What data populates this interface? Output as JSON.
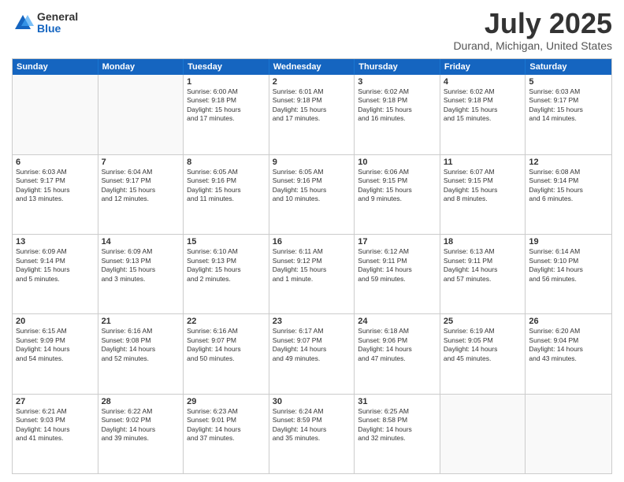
{
  "header": {
    "logo_general": "General",
    "logo_blue": "Blue",
    "month_year": "July 2025",
    "location": "Durand, Michigan, United States"
  },
  "days_of_week": [
    "Sunday",
    "Monday",
    "Tuesday",
    "Wednesday",
    "Thursday",
    "Friday",
    "Saturday"
  ],
  "weeks": [
    [
      {
        "day": "",
        "text": ""
      },
      {
        "day": "",
        "text": ""
      },
      {
        "day": "1",
        "text": "Sunrise: 6:00 AM\nSunset: 9:18 PM\nDaylight: 15 hours\nand 17 minutes."
      },
      {
        "day": "2",
        "text": "Sunrise: 6:01 AM\nSunset: 9:18 PM\nDaylight: 15 hours\nand 17 minutes."
      },
      {
        "day": "3",
        "text": "Sunrise: 6:02 AM\nSunset: 9:18 PM\nDaylight: 15 hours\nand 16 minutes."
      },
      {
        "day": "4",
        "text": "Sunrise: 6:02 AM\nSunset: 9:18 PM\nDaylight: 15 hours\nand 15 minutes."
      },
      {
        "day": "5",
        "text": "Sunrise: 6:03 AM\nSunset: 9:17 PM\nDaylight: 15 hours\nand 14 minutes."
      }
    ],
    [
      {
        "day": "6",
        "text": "Sunrise: 6:03 AM\nSunset: 9:17 PM\nDaylight: 15 hours\nand 13 minutes."
      },
      {
        "day": "7",
        "text": "Sunrise: 6:04 AM\nSunset: 9:17 PM\nDaylight: 15 hours\nand 12 minutes."
      },
      {
        "day": "8",
        "text": "Sunrise: 6:05 AM\nSunset: 9:16 PM\nDaylight: 15 hours\nand 11 minutes."
      },
      {
        "day": "9",
        "text": "Sunrise: 6:05 AM\nSunset: 9:16 PM\nDaylight: 15 hours\nand 10 minutes."
      },
      {
        "day": "10",
        "text": "Sunrise: 6:06 AM\nSunset: 9:15 PM\nDaylight: 15 hours\nand 9 minutes."
      },
      {
        "day": "11",
        "text": "Sunrise: 6:07 AM\nSunset: 9:15 PM\nDaylight: 15 hours\nand 8 minutes."
      },
      {
        "day": "12",
        "text": "Sunrise: 6:08 AM\nSunset: 9:14 PM\nDaylight: 15 hours\nand 6 minutes."
      }
    ],
    [
      {
        "day": "13",
        "text": "Sunrise: 6:09 AM\nSunset: 9:14 PM\nDaylight: 15 hours\nand 5 minutes."
      },
      {
        "day": "14",
        "text": "Sunrise: 6:09 AM\nSunset: 9:13 PM\nDaylight: 15 hours\nand 3 minutes."
      },
      {
        "day": "15",
        "text": "Sunrise: 6:10 AM\nSunset: 9:13 PM\nDaylight: 15 hours\nand 2 minutes."
      },
      {
        "day": "16",
        "text": "Sunrise: 6:11 AM\nSunset: 9:12 PM\nDaylight: 15 hours\nand 1 minute."
      },
      {
        "day": "17",
        "text": "Sunrise: 6:12 AM\nSunset: 9:11 PM\nDaylight: 14 hours\nand 59 minutes."
      },
      {
        "day": "18",
        "text": "Sunrise: 6:13 AM\nSunset: 9:11 PM\nDaylight: 14 hours\nand 57 minutes."
      },
      {
        "day": "19",
        "text": "Sunrise: 6:14 AM\nSunset: 9:10 PM\nDaylight: 14 hours\nand 56 minutes."
      }
    ],
    [
      {
        "day": "20",
        "text": "Sunrise: 6:15 AM\nSunset: 9:09 PM\nDaylight: 14 hours\nand 54 minutes."
      },
      {
        "day": "21",
        "text": "Sunrise: 6:16 AM\nSunset: 9:08 PM\nDaylight: 14 hours\nand 52 minutes."
      },
      {
        "day": "22",
        "text": "Sunrise: 6:16 AM\nSunset: 9:07 PM\nDaylight: 14 hours\nand 50 minutes."
      },
      {
        "day": "23",
        "text": "Sunrise: 6:17 AM\nSunset: 9:07 PM\nDaylight: 14 hours\nand 49 minutes."
      },
      {
        "day": "24",
        "text": "Sunrise: 6:18 AM\nSunset: 9:06 PM\nDaylight: 14 hours\nand 47 minutes."
      },
      {
        "day": "25",
        "text": "Sunrise: 6:19 AM\nSunset: 9:05 PM\nDaylight: 14 hours\nand 45 minutes."
      },
      {
        "day": "26",
        "text": "Sunrise: 6:20 AM\nSunset: 9:04 PM\nDaylight: 14 hours\nand 43 minutes."
      }
    ],
    [
      {
        "day": "27",
        "text": "Sunrise: 6:21 AM\nSunset: 9:03 PM\nDaylight: 14 hours\nand 41 minutes."
      },
      {
        "day": "28",
        "text": "Sunrise: 6:22 AM\nSunset: 9:02 PM\nDaylight: 14 hours\nand 39 minutes."
      },
      {
        "day": "29",
        "text": "Sunrise: 6:23 AM\nSunset: 9:01 PM\nDaylight: 14 hours\nand 37 minutes."
      },
      {
        "day": "30",
        "text": "Sunrise: 6:24 AM\nSunset: 8:59 PM\nDaylight: 14 hours\nand 35 minutes."
      },
      {
        "day": "31",
        "text": "Sunrise: 6:25 AM\nSunset: 8:58 PM\nDaylight: 14 hours\nand 32 minutes."
      },
      {
        "day": "",
        "text": ""
      },
      {
        "day": "",
        "text": ""
      }
    ]
  ]
}
